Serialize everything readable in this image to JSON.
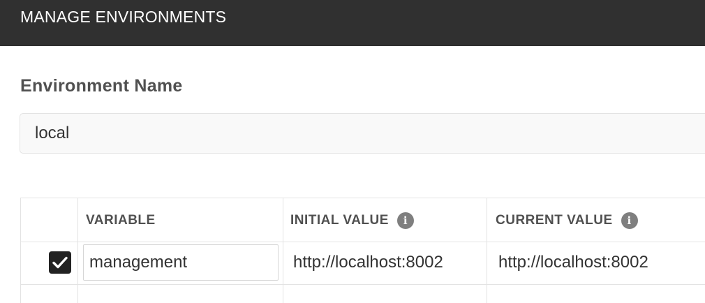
{
  "header": {
    "title": "MANAGE ENVIRONMENTS"
  },
  "environment": {
    "label": "Environment Name",
    "value": "local"
  },
  "table": {
    "columns": {
      "variable": "VARIABLE",
      "initial_value": "INITIAL VALUE",
      "current_value": "CURRENT VALUE"
    },
    "info_icon_glyph": "i",
    "rows": [
      {
        "checked": true,
        "variable": "management",
        "initial_value": "http://localhost:8002",
        "current_value": "http://localhost:8002"
      }
    ]
  },
  "colors": {
    "header_bg": "#303030",
    "checkbox_bg": "#222222",
    "info_icon_bg": "#7f7f7f"
  }
}
